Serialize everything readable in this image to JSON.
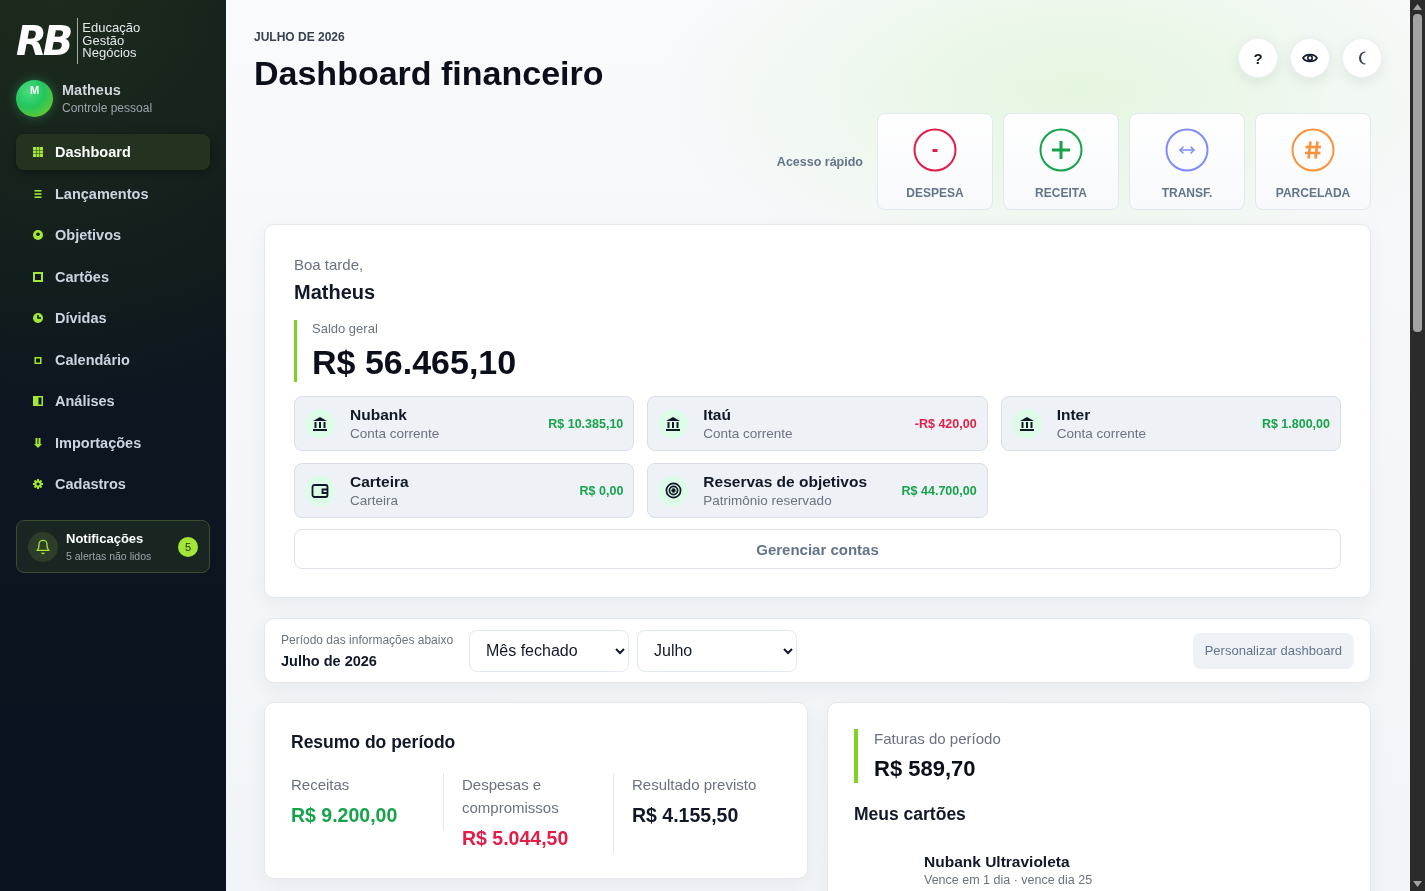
{
  "sidebar": {
    "logo": {
      "mark": "RB",
      "tagline": [
        "Educação",
        "Gestão",
        "Negócios"
      ]
    },
    "user": {
      "initial": "M",
      "name": "Matheus",
      "plan": "Controle pessoal"
    },
    "nav": [
      {
        "label": "Dashboard",
        "selected": true
      },
      {
        "label": "Lançamentos",
        "selected": false
      },
      {
        "label": "Objetivos",
        "selected": false
      },
      {
        "label": "Cartões",
        "selected": false
      },
      {
        "label": "Dívidas",
        "selected": false
      },
      {
        "label": "Calendário",
        "selected": false
      },
      {
        "label": "Análises",
        "selected": false
      },
      {
        "label": "Importações",
        "selected": false
      },
      {
        "label": "Cadastros",
        "selected": false
      }
    ],
    "notifications": {
      "title": "Notificações",
      "subtitle": "5 alertas não lidos",
      "count": "5"
    }
  },
  "header": {
    "eyebrow": "JULHO DE 2026",
    "title": "Dashboard financeiro",
    "help_button": "?"
  },
  "quick_access": {
    "label": "Acesso rápido",
    "actions": [
      {
        "kind": "expense",
        "label": "DESPESA",
        "color": "#e11d48"
      },
      {
        "kind": "income",
        "label": "RECEITA",
        "color": "#16a34a"
      },
      {
        "kind": "transfer",
        "label": "TRANSF.",
        "color": "#818cf8"
      },
      {
        "kind": "installment",
        "label": "PARCELADA",
        "color": "#fb923c"
      }
    ]
  },
  "overview": {
    "greeting": "Boa tarde,",
    "name": "Matheus",
    "balance_label": "Saldo geral",
    "balance": "R$ 56.465,10",
    "accounts": [
      {
        "kind": "bank",
        "name": "Nubank",
        "type": "Conta corrente",
        "amount": "R$ 10.385,10",
        "color": "#16a34a"
      },
      {
        "kind": "bank",
        "name": "Itaú",
        "type": "Conta corrente",
        "amount": "-R$ 420,00",
        "color": "#e11d48"
      },
      {
        "kind": "bank",
        "name": "Inter",
        "type": "Conta corrente",
        "amount": "R$ 1.800,00",
        "color": "#16a34a"
      },
      {
        "kind": "wallet",
        "name": "Carteira",
        "type": "Carteira",
        "amount": "R$ 0,00",
        "color": "#16a34a"
      },
      {
        "kind": "reserve",
        "name": "Reservas de objetivos",
        "type": "Patrimônio reservado",
        "amount": "R$ 44.700,00",
        "color": "#16a34a"
      }
    ],
    "manage_button": "Gerenciar contas"
  },
  "period": {
    "label": "Período das informações abaixo",
    "value": "Julho de 2026",
    "mode": "Mês fechado",
    "month": "Julho",
    "customize_button": "Personalizar dashboard"
  },
  "summary": {
    "title": "Resumo do período",
    "items": [
      {
        "label": "Receitas",
        "value": "R$ 9.200,00",
        "color": "#16a34a"
      },
      {
        "label": "Despesas e compromissos",
        "value": "R$ 5.044,50",
        "color": "#e11d48"
      },
      {
        "label": "Resultado previsto",
        "value": "R$ 4.155,50",
        "color": "#111827"
      }
    ]
  },
  "cards_panel": {
    "invoices_label": "Faturas do período",
    "invoices_total": "R$ 589,70",
    "title": "Meus cartões",
    "cards": [
      {
        "name": "Nubank Ultravioleta",
        "due": "Vence em 1 dia · vence dia 25"
      }
    ]
  }
}
